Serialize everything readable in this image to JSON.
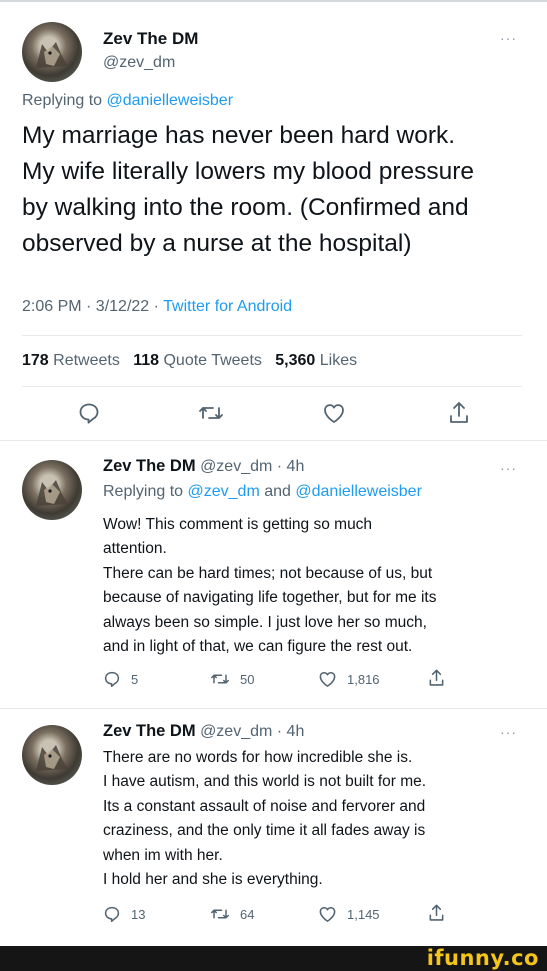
{
  "tweet": {
    "name": "Zev The DM",
    "handle": "@zev_dm",
    "more": "···",
    "replying_label": "Replying to",
    "replying_to": "@danielleweisber",
    "text": [
      "My marriage has never been hard work.",
      "My wife literally lowers my blood pressure",
      "by walking into the room. (Confirmed and",
      "observed by a nurse at the hospital)"
    ],
    "time": "2:06 PM · 3/12/22 ·",
    "client": "Twitter for Android",
    "retweets_count": "178",
    "retweets_label": "Retweets",
    "quotes_count": "118",
    "quotes_label": "Quote Tweets",
    "likes_count": "5,360",
    "likes_label": "Likes"
  },
  "replies": [
    {
      "name": "Zev The DM",
      "handle_time": "@zev_dm · 4h",
      "more": "···",
      "replying_label": "Replying to",
      "replying_to_1": "@zev_dm",
      "and": "and",
      "replying_to_2": "@danielleweisber",
      "lines": [
        "Wow! This comment is getting so much",
        "attention.",
        "There can be hard times; not because of us, but",
        "because of navigating life together, but for me its",
        "always been so simple.  I just love her so much,",
        "and in light of that, we can figure the rest out."
      ],
      "reply_count": "5",
      "retweet_count": "50",
      "like_count": "1,816"
    },
    {
      "name": "Zev The DM",
      "handle_time": "@zev_dm · 4h",
      "more": "···",
      "lines": [
        "There are no words for how incredible she is.",
        "I have autism, and this world is not built for me.",
        "Its a constant assault of noise and fervorer and",
        "craziness, and the only time it all fades away is",
        "when im with her.",
        "I hold her and she is everything."
      ],
      "reply_count": "13",
      "retweet_count": "64",
      "like_count": "1,145"
    }
  ],
  "watermark": "ifunny.co"
}
